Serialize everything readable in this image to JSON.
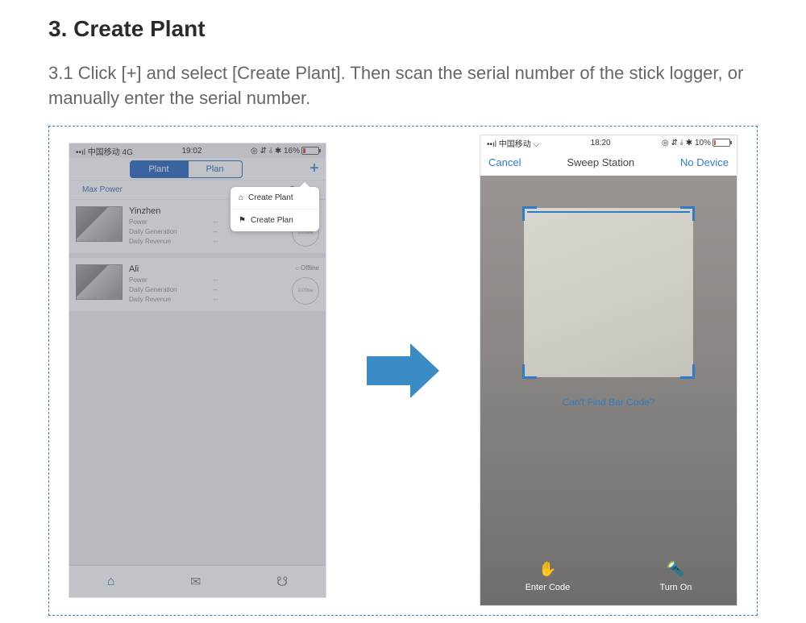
{
  "doc": {
    "heading": "3. Create Plant",
    "instruction": "3.1 Click [+] and select [Create Plant]. Then scan the serial number of the stick logger, or manually enter the serial number."
  },
  "left": {
    "status": {
      "carrier": "••ıl 中国移动 4G",
      "time": "19:02",
      "right": "◎ ⇵ ⫰ ✱ 16%"
    },
    "tabs": {
      "a": "Plant",
      "b": "Plan"
    },
    "filters": {
      "a": "Max Power",
      "b": "Daily r"
    },
    "dropdown": {
      "item1": "Create Plant",
      "item2": "Create Plan"
    },
    "plant1": {
      "name": "Yinzhen",
      "r1": "Power",
      "r2": "Daily Generation",
      "r3": "Daily Revenue",
      "v1": "--",
      "v2": "--",
      "v3": "--",
      "gauge": "0.00kw"
    },
    "plant2": {
      "name": "Ali",
      "status": "Offline",
      "r1": "Power",
      "r2": "Daily Generation",
      "r3": "Daily Revenue",
      "v1": "--",
      "v2": "--",
      "v3": "--",
      "gauge": "0.00kw"
    }
  },
  "right": {
    "status": {
      "carrier": "••ıl 中国移动 ⌵",
      "time": "18:20",
      "right": "◎ ⇵ ⫰ ✱ 10%"
    },
    "header": {
      "cancel": "Cancel",
      "title": "Sweep Station",
      "nodevice": "No Device"
    },
    "msg": "Can't Find Bar Code?",
    "opt1": "Enter Code",
    "opt2": "Turn On"
  }
}
